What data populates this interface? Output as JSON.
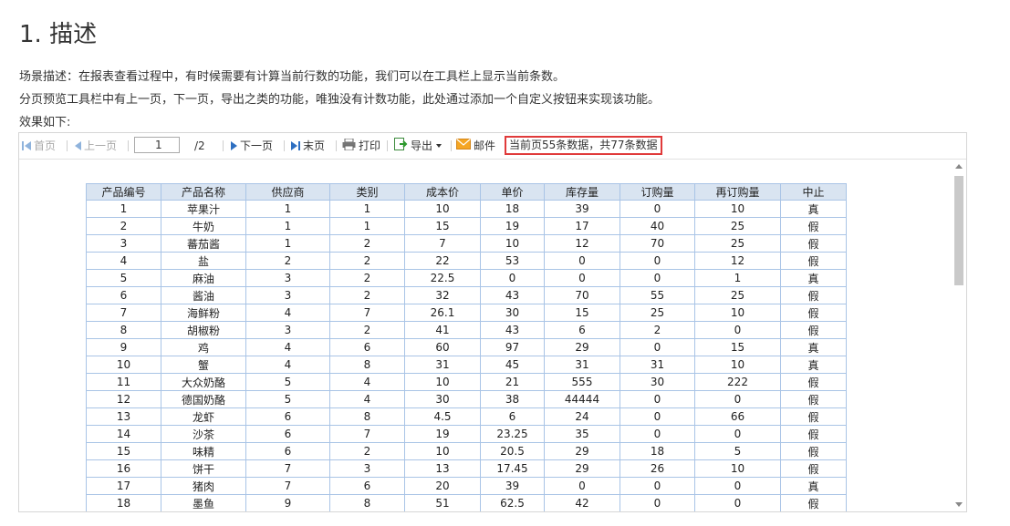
{
  "heading": "1. 描述",
  "paragraphs": [
    "场景描述：在报表查看过程中，有时候需要有计算当前行数的功能，我们可以在工具栏上显示当前条数。",
    "分页预览工具栏中有上一页，下一页，导出之类的功能，唯独没有计数功能，此处通过添加一个自定义按钮来实现该功能。",
    "效果如下:"
  ],
  "toolbar": {
    "first": "首页",
    "prev": "上一页",
    "page_value": "1",
    "total_pages": "/2",
    "next": "下一页",
    "last": "末页",
    "print": "打印",
    "export": "导出",
    "mail": "邮件",
    "status": "当前页55条数据，共77条数据"
  },
  "table": {
    "headers": [
      "产品编号",
      "产品名称",
      "供应商",
      "类别",
      "成本价",
      "单价",
      "库存量",
      "订购量",
      "再订购量",
      "中止"
    ],
    "rows": [
      [
        "1",
        "苹果汁",
        "1",
        "1",
        "10",
        "18",
        "39",
        "0",
        "10",
        "真"
      ],
      [
        "2",
        "牛奶",
        "1",
        "1",
        "15",
        "19",
        "17",
        "40",
        "25",
        "假"
      ],
      [
        "3",
        "蕃茄酱",
        "1",
        "2",
        "7",
        "10",
        "12",
        "70",
        "25",
        "假"
      ],
      [
        "4",
        "盐",
        "2",
        "2",
        "22",
        "53",
        "0",
        "0",
        "12",
        "假"
      ],
      [
        "5",
        "麻油",
        "3",
        "2",
        "22.5",
        "0",
        "0",
        "0",
        "1",
        "真"
      ],
      [
        "6",
        "酱油",
        "3",
        "2",
        "32",
        "43",
        "70",
        "55",
        "25",
        "假"
      ],
      [
        "7",
        "海鲜粉",
        "4",
        "7",
        "26.1",
        "30",
        "15",
        "25",
        "10",
        "假"
      ],
      [
        "8",
        "胡椒粉",
        "3",
        "2",
        "41",
        "43",
        "6",
        "2",
        "0",
        "假"
      ],
      [
        "9",
        "鸡",
        "4",
        "6",
        "60",
        "97",
        "29",
        "0",
        "15",
        "真"
      ],
      [
        "10",
        "蟹",
        "4",
        "8",
        "31",
        "45",
        "31",
        "31",
        "10",
        "真"
      ],
      [
        "11",
        "大众奶酪",
        "5",
        "4",
        "10",
        "21",
        "555",
        "30",
        "222",
        "假"
      ],
      [
        "12",
        "德国奶酪",
        "5",
        "4",
        "30",
        "38",
        "44444",
        "0",
        "0",
        "假"
      ],
      [
        "13",
        "龙虾",
        "6",
        "8",
        "4.5",
        "6",
        "24",
        "0",
        "66",
        "假"
      ],
      [
        "14",
        "沙茶",
        "6",
        "7",
        "19",
        "23.25",
        "35",
        "0",
        "0",
        "假"
      ],
      [
        "15",
        "味精",
        "6",
        "2",
        "10",
        "20.5",
        "29",
        "18",
        "5",
        "假"
      ],
      [
        "16",
        "饼干",
        "7",
        "3",
        "13",
        "17.45",
        "29",
        "26",
        "10",
        "假"
      ],
      [
        "17",
        "猪肉",
        "7",
        "6",
        "20",
        "39",
        "0",
        "0",
        "0",
        "真"
      ],
      [
        "18",
        "墨鱼",
        "9",
        "8",
        "51",
        "62.5",
        "42",
        "0",
        "0",
        "假"
      ]
    ]
  }
}
